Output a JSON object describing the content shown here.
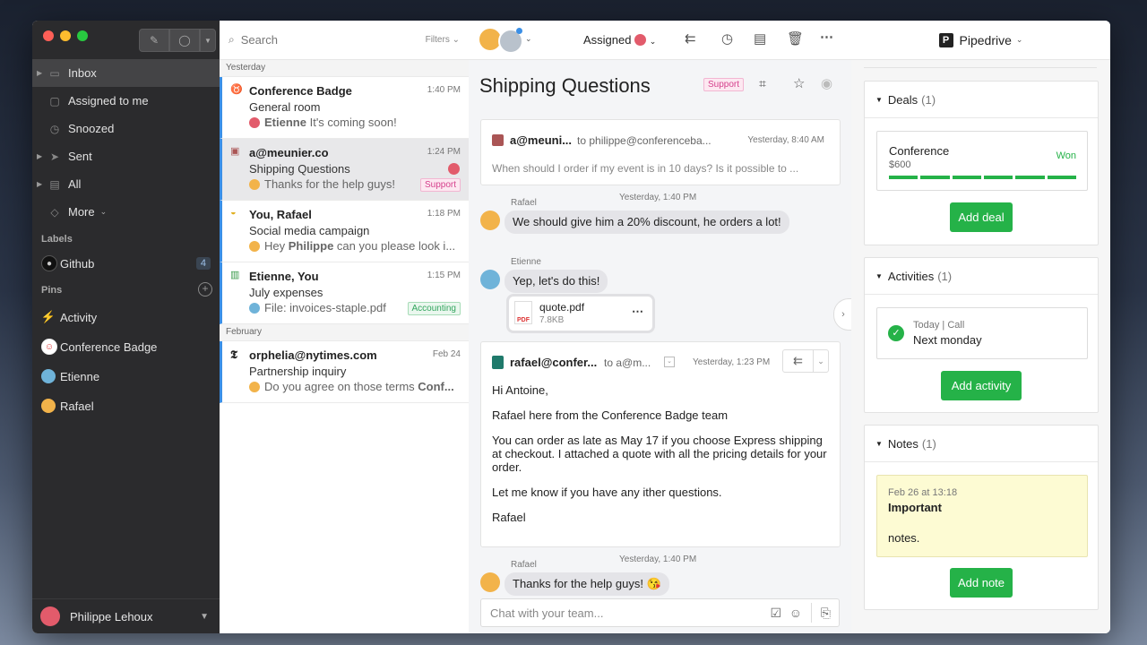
{
  "sidebar": {
    "nav": [
      {
        "label": "Inbox",
        "icon": "inbox-icon",
        "active": true,
        "caret": true
      },
      {
        "label": "Assigned to me",
        "icon": "assigned-icon"
      },
      {
        "label": "Snoozed",
        "icon": "clock-icon"
      },
      {
        "label": "Sent",
        "icon": "send-icon",
        "caret": true
      },
      {
        "label": "All",
        "icon": "archive-icon",
        "caret": true
      },
      {
        "label": "More",
        "icon": "tag-icon"
      }
    ],
    "labels_title": "Labels",
    "labels": [
      {
        "label": "Github",
        "count": "4",
        "icon": "github-icon"
      }
    ],
    "pins_title": "Pins",
    "pins": [
      {
        "label": "Activity",
        "icon": "lightning-icon"
      },
      {
        "label": "Conference Badge",
        "icon": "badge-icon"
      },
      {
        "label": "Etienne",
        "icon": "avatar"
      },
      {
        "label": "Rafael",
        "icon": "avatar"
      }
    ],
    "user": "Philippe Lehoux"
  },
  "list": {
    "search_placeholder": "Search",
    "filters": "Filters",
    "group_yesterday": "Yesterday",
    "group_february": "February",
    "conversations": [
      {
        "from": "Conference Badge",
        "time": "1:40 PM",
        "subject": "General room",
        "preview_name": "Etienne",
        "preview": "It's coming soon!"
      },
      {
        "from": "a@meunier.co",
        "time": "1:24 PM",
        "subject": "Shipping Questions",
        "preview": "Thanks for the help guys! 😘",
        "tag": "Support"
      },
      {
        "from": "You, Rafael",
        "time": "1:18 PM",
        "subject": "Social media campaign",
        "preview_pre": "Hey ",
        "preview_name": "Philippe",
        "preview": " can you please look i..."
      },
      {
        "from": "Etienne, You",
        "time": "1:15 PM",
        "subject": "July expenses",
        "preview": "File: invoices-staple.pdf",
        "tag": "Accounting"
      },
      {
        "from": "orphelia@nytimes.com",
        "time": "Feb 24",
        "subject": "Partnership inquiry",
        "preview": "Do you agree on those terms ",
        "preview_bold": "Conf..."
      }
    ]
  },
  "panel": {
    "assigned": "Assigned",
    "title": "Shipping Questions",
    "tag": "Support",
    "email1": {
      "from": "a@meuni...",
      "to": "to philippe@conferenceba...",
      "time": "Yesterday, 8:40 AM",
      "body": "When should I order if my event is in 10 days? Is it possible to ..."
    },
    "msg1": {
      "who": "Rafael",
      "time": "Yesterday, 1:40 PM",
      "text": "We should give him a 20% discount, he orders a lot!"
    },
    "msg2": {
      "who": "Etienne",
      "text": "Yep, let's do this!"
    },
    "file": {
      "name": "quote.pdf",
      "size": "7.8KB",
      "badge": "PDF"
    },
    "email2": {
      "from": "rafael@confer...",
      "to": "to a@m...",
      "time": "Yesterday, 1:23 PM",
      "lines": [
        "Hi Antoine,",
        "Rafael here from the Conference Badge team",
        "You can order as late as May 17 if you choose Express shipping at checkout. I attached a quote with all the pricing details for your order.",
        "Let me know if you have any ither questions.",
        "Rafael"
      ]
    },
    "msg3": {
      "who": "Rafael",
      "time": "Yesterday, 1:40 PM",
      "text": "Thanks for the help guys! 😘"
    },
    "chat_placeholder": "Chat with your team..."
  },
  "pipedrive": {
    "title": "Pipedrive",
    "deals": {
      "title": "Deals",
      "count": "(1)",
      "name": "Conference",
      "value": "$600",
      "status": "Won",
      "button": "Add deal",
      "progress": 1.0
    },
    "activities": {
      "title": "Activities",
      "count": "(1)",
      "meta": "Today | Call",
      "name": "Next monday",
      "button": "Add activity"
    },
    "notes": {
      "title": "Notes",
      "count": "(1)",
      "date": "Feb 26 at 13:18",
      "heading": "Important",
      "body": "notes.",
      "button": "Add note"
    }
  },
  "colors": {
    "green": "#25b248",
    "blue": "#3a8fe6",
    "support": "#d5408c",
    "accounting": "#33a55e"
  }
}
